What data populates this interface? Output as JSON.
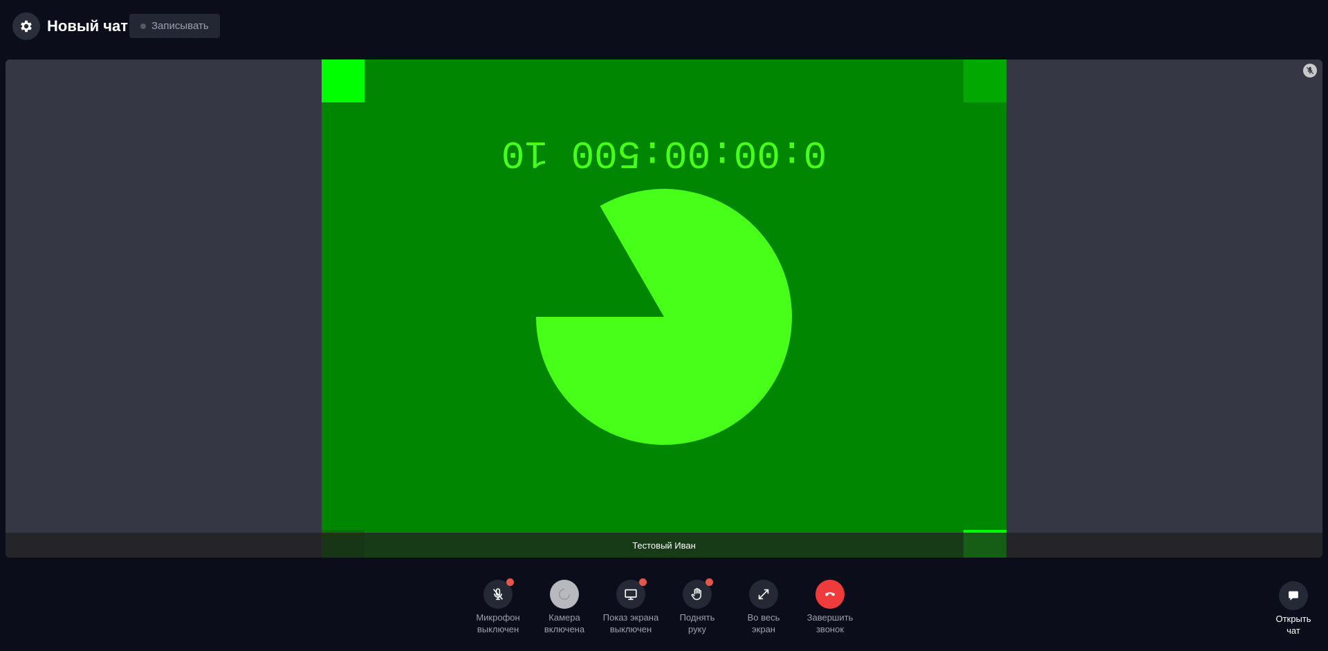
{
  "header": {
    "settings_icon": "gear-icon",
    "title": "Новый чат",
    "record_label": "Записывать"
  },
  "video": {
    "participant_name": "Тестовый Иван",
    "timer_text": "0:00:00:500 10",
    "colors": {
      "background": "#008600",
      "pie": "#47ff18",
      "corner_bright": "#00ff00",
      "corner_dim": "#00a800"
    },
    "pie_missing_fraction": 0.1667
  },
  "controls": {
    "mic": {
      "line1": "Микрофон",
      "line2": "выключен",
      "icon": "mic-off-icon",
      "badge": true
    },
    "camera": {
      "line1": "Камера",
      "line2": "включена",
      "icon": "loading-spinner-icon",
      "badge": false
    },
    "screen": {
      "line1": "Показ экрана",
      "line2": "выключен",
      "icon": "monitor-icon",
      "badge": true
    },
    "hand": {
      "line1": "Поднять",
      "line2": "руку",
      "icon": "hand-icon",
      "badge": true
    },
    "fullscreen": {
      "line1": "Во весь",
      "line2": "экран",
      "icon": "expand-icon",
      "badge": false
    },
    "end": {
      "line1": "Завершить",
      "line2": "звонок",
      "icon": "hangup-icon",
      "badge": false
    }
  },
  "chat": {
    "line1": "Открыть",
    "line2": "чат",
    "icon": "chat-bubble-icon"
  }
}
